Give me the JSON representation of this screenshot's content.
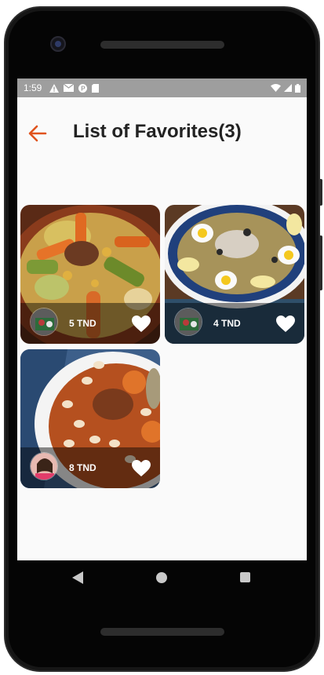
{
  "status_bar": {
    "time": "1:59",
    "left_icons": [
      "warning-icon",
      "mail-icon",
      "badge-icon",
      "sd-card-icon"
    ],
    "right_icons": [
      "wifi-icon",
      "signal-icon",
      "battery-icon"
    ]
  },
  "app_bar": {
    "back_icon": "arrow-left-icon",
    "title": "List of Favorites(3)"
  },
  "favorites": [
    {
      "price": "5 TND",
      "dish": "couscous",
      "favorite": true
    },
    {
      "price": "4 TND",
      "dish": "salad-with-eggs",
      "favorite": true
    },
    {
      "price": "8 TND",
      "dish": "bean-stew",
      "favorite": true
    }
  ],
  "colors": {
    "accent": "#e0541e",
    "title_text": "#222222",
    "screen_bg": "#fafafa",
    "status_bar_bg": "#9e9e9e",
    "device_body": "#161616"
  },
  "nav_bar": {
    "icons": [
      "nav-back-icon",
      "nav-home-icon",
      "nav-recents-icon"
    ]
  }
}
